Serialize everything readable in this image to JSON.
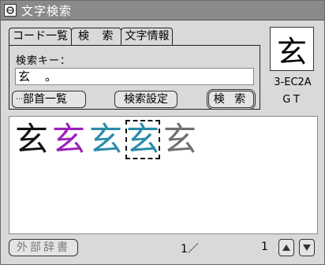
{
  "window": {
    "title": "文字検索"
  },
  "tabs": [
    "コード一覧",
    "検 索",
    "文字情報"
  ],
  "active_tab": 1,
  "search": {
    "key_label": "検索キー：",
    "key_value": "玄　。",
    "radical_button": "部首一覧",
    "settings_button": "検索設定",
    "search_button": "検 索"
  },
  "preview": {
    "glyph": "玄",
    "code": "3-EC2A",
    "font": "GT"
  },
  "results": {
    "glyphs": [
      {
        "char": "玄",
        "color": "#111111"
      },
      {
        "char": "玄",
        "color": "#9b1fb8"
      },
      {
        "char": "玄",
        "color": "#2a8aa8"
      },
      {
        "char": "玄",
        "color": "#2a8aa8"
      },
      {
        "char": "玄",
        "color": "#6f6f6f"
      }
    ],
    "selected_index": 3
  },
  "footer": {
    "external_dict_button": "外部辞書",
    "page_current": "1／",
    "page_total": "1"
  },
  "icons": {
    "title": "app-icon",
    "up": "up-arrow-icon",
    "down": "down-arrow-icon"
  }
}
